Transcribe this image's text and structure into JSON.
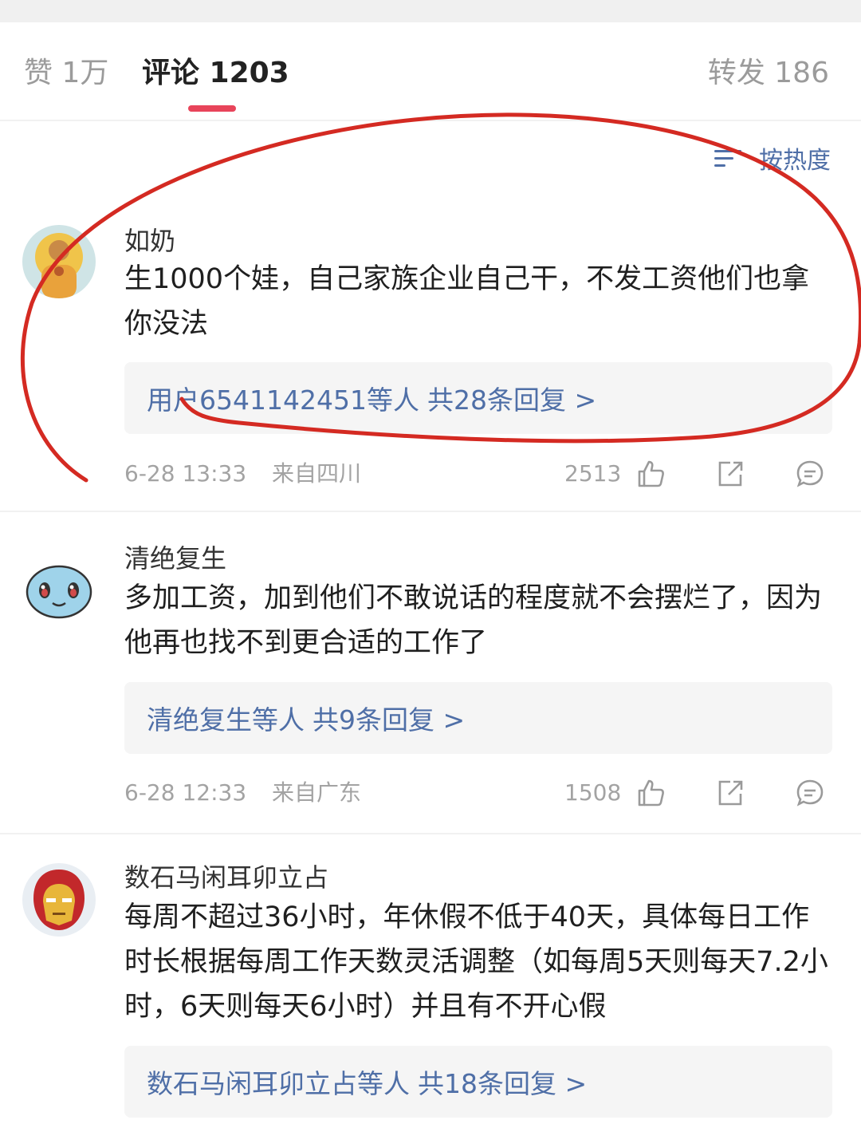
{
  "tabs": {
    "likes": "赞 1万",
    "comments": "评论 1203",
    "reposts": "转发 186"
  },
  "sort": {
    "label": "按热度",
    "icon": "sort-icon"
  },
  "comments": [
    {
      "username": "如奶",
      "text": "生1000个娃，自己家族企业自己干，不发工资他们也拿你没法",
      "replies": {
        "who": "用户6541142451等人",
        "count": "共28条回复 >"
      },
      "time": "6-28 13:33",
      "location": "来自四川",
      "likes": "2513"
    },
    {
      "username": "清绝复生",
      "text": "多加工资，加到他们不敢说话的程度就不会摆烂了，因为他再也找不到更合适的工作了",
      "replies": {
        "who": "清绝复生等人",
        "count": "共9条回复 >"
      },
      "time": "6-28 12:33",
      "location": "来自广东",
      "likes": "1508"
    },
    {
      "username": "数石马闲耳卯立占",
      "text": "每周不超过36小时，年休假不低于40天，具体每日工作时长根据每周工作天数灵活调整（如每周5天则每天7.2小时，6天则每天6小时）并且有不开心假",
      "replies": {
        "who": "数石马闲耳卯立占等人",
        "count": "共18条回复 >"
      }
    }
  ],
  "colors": {
    "accent_underline": "#e8445a",
    "link_blue": "#4f6fa7",
    "annotation_red": "#d42a22",
    "meta_gray": "#a3a3a3"
  },
  "icons": [
    "thumbs-up-icon",
    "share-icon",
    "comment-icon",
    "sort-icon"
  ]
}
